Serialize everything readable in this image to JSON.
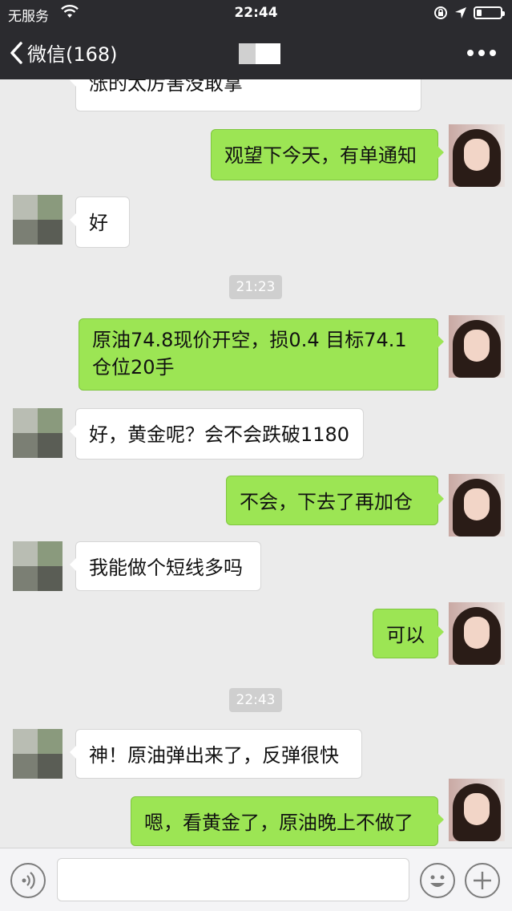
{
  "status_bar": {
    "carrier": "无服务",
    "time": "22:44",
    "battery_level": 0.2
  },
  "nav": {
    "back_label": "微信(168)"
  },
  "messages": [
    {
      "side": "in",
      "text": "涨的太厉害没敢拿"
    },
    {
      "side": "out",
      "text": "观望下今天，有单通知"
    },
    {
      "side": "in",
      "text": "好"
    },
    {
      "side": "time",
      "text": "21:23"
    },
    {
      "side": "out",
      "text": "原油74.8现价开空，损0.4 目标74.1 仓位20手"
    },
    {
      "side": "in",
      "text": "好，黄金呢？会不会跌破1180"
    },
    {
      "side": "out",
      "text": "不会，下去了再加仓"
    },
    {
      "side": "in",
      "text": "我能做个短线多吗"
    },
    {
      "side": "out",
      "text": "可以"
    },
    {
      "side": "time",
      "text": "22:43"
    },
    {
      "side": "in",
      "text": "神！原油弹出来了，反弹很快"
    },
    {
      "side": "out",
      "text": "嗯，看黄金了，原油晚上不做了"
    }
  ],
  "input": {
    "placeholder": ""
  },
  "icons": {
    "wifi": "wifi-icon",
    "lock_rotation": "rotation-lock-icon",
    "location": "location-arrow-icon",
    "back": "chevron-left-icon",
    "more": "more-dots-icon",
    "voice": "voice-icon",
    "emoji": "emoji-icon",
    "add": "plus-icon"
  },
  "colors": {
    "bar": "#2b2b2f",
    "chat_bg": "#ebebeb",
    "outgoing_bubble": "#9ce554",
    "incoming_bubble": "#ffffff"
  }
}
